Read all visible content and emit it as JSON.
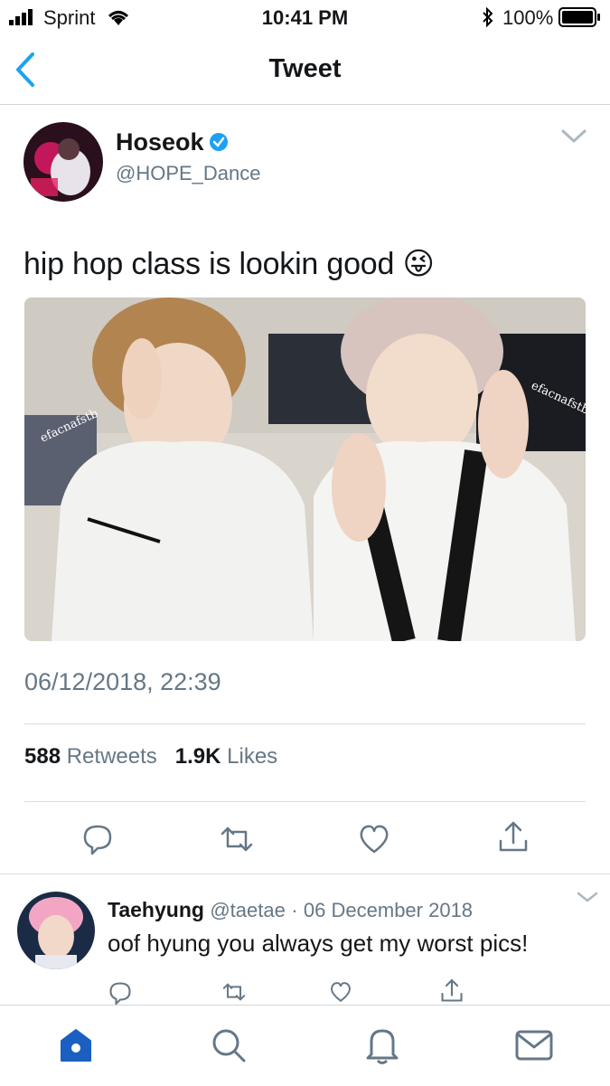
{
  "status_bar": {
    "carrier": "Sprint",
    "time": "10:41 PM",
    "battery": "100%"
  },
  "nav": {
    "title": "Tweet"
  },
  "tweet": {
    "author_name": "Hoseok",
    "author_handle": "@HOPE_Dance",
    "text": "hip hop class is lookin good",
    "emoji": "😜",
    "photo_watermark": "efacnafstb",
    "timestamp": "06/12/2018, 22:39",
    "retweet_count": "588",
    "retweet_label": "Retweets",
    "like_count": "1.9K",
    "like_label": "Likes"
  },
  "reply": {
    "author_name": "Taehyung",
    "author_handle": "@taetae",
    "separator": "·",
    "date": "06 December 2018",
    "text": "oof hyung you always get my worst pics!"
  },
  "colors": {
    "accent": "#1da1f2",
    "tab_active": "#1b5fc1",
    "muted": "#657786",
    "verified": "#1da1f2"
  },
  "icons": {
    "back": "chevron-left-icon",
    "reply": "reply-icon",
    "retweet": "retweet-icon",
    "like": "heart-icon",
    "share": "share-icon",
    "home": "home-icon",
    "search": "search-icon",
    "notifications": "bell-icon",
    "messages": "mail-icon"
  }
}
